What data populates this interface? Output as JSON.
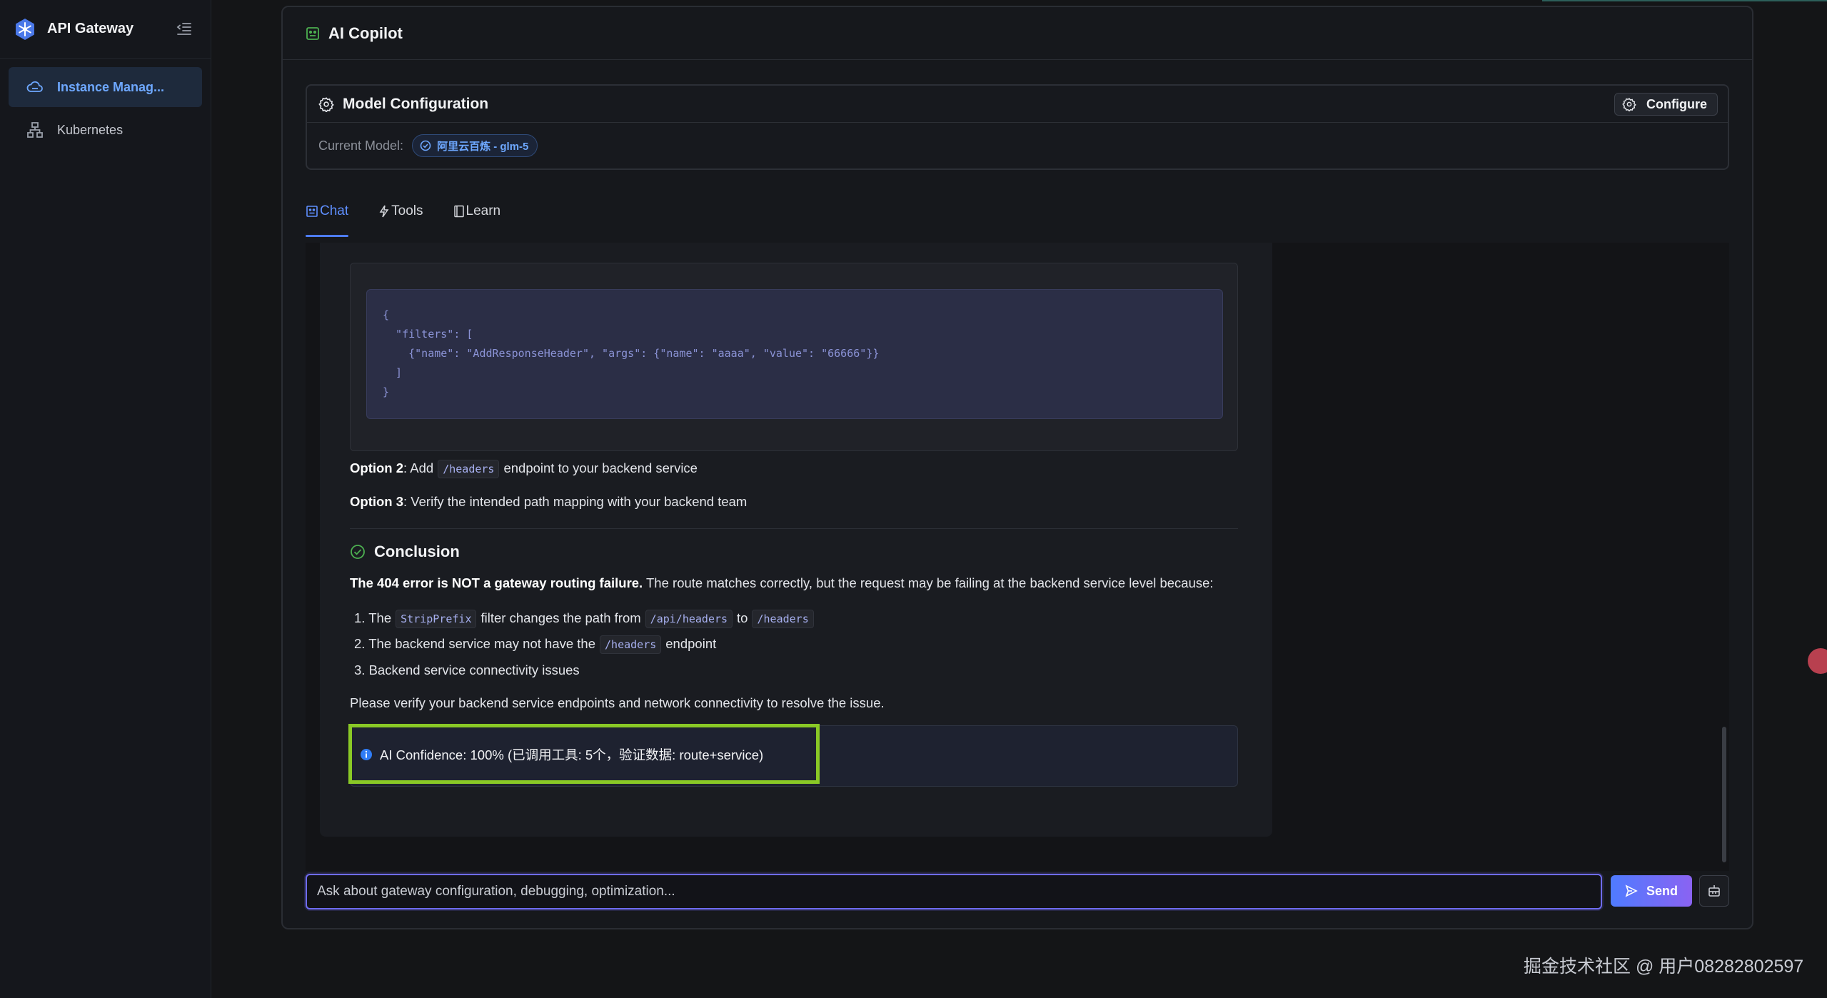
{
  "sidebar": {
    "brand": "API Gateway",
    "items": [
      {
        "label": "Instance Manag...",
        "icon": "cloud-icon",
        "active": true
      },
      {
        "label": "Kubernetes",
        "icon": "sitemap-icon",
        "active": false
      }
    ]
  },
  "panel": {
    "title": "AI Copilot",
    "model_config": {
      "title": "Model Configuration",
      "configure_label": "Configure",
      "current_model_label": "Current Model:",
      "current_model_value": "阿里云百炼 - glm-5"
    },
    "tabs": [
      {
        "label": "Chat",
        "icon": "chat-icon",
        "active": true
      },
      {
        "label": "Tools",
        "icon": "bolt-icon",
        "active": false
      },
      {
        "label": "Learn",
        "icon": "book-icon",
        "active": false
      }
    ]
  },
  "message": {
    "code": "{\n  \"filters\": [\n    {\"name\": \"AddResponseHeader\", \"args\": {\"name\": \"aaaa\", \"value\": \"66666\"}}\n  ]\n}",
    "option2": {
      "label": "Option 2",
      "pre": ": Add",
      "code": "/headers",
      "post": "endpoint to your backend service"
    },
    "option3": {
      "label": "Option 3",
      "text": ": Verify the intended path mapping with your backend team"
    },
    "conclusion_title": "Conclusion",
    "conclusion_bold": "The 404 error is NOT a gateway routing failure.",
    "conclusion_rest": " The route matches correctly, but the request may be failing at the backend service level because:",
    "list": {
      "item1": {
        "num": "1.",
        "pre": "The",
        "code1": "StripPrefix",
        "mid": "filter changes the path from",
        "code2": "/api/headers",
        "to": "to",
        "code3": "/headers"
      },
      "item2": {
        "num": "2.",
        "pre": "The backend service may not have the",
        "code": "/headers",
        "post": "endpoint"
      },
      "item3": {
        "num": "3.",
        "text": "Backend service connectivity issues"
      }
    },
    "closing": "Please verify your backend service endpoints and network connectivity to resolve the issue.",
    "confidence": "AI Confidence: 100% (已调用工具: 5个，验证数据: route+service)"
  },
  "input": {
    "placeholder": "Ask about gateway configuration, debugging, optimization...",
    "send_label": "Send"
  },
  "watermark": "掘金技术社区 @ 用户08282802597",
  "colors": {
    "accent": "#4d7cff",
    "highlight_box": "#8ac926",
    "success": "#4caf50",
    "info": "#2f7cf6"
  }
}
